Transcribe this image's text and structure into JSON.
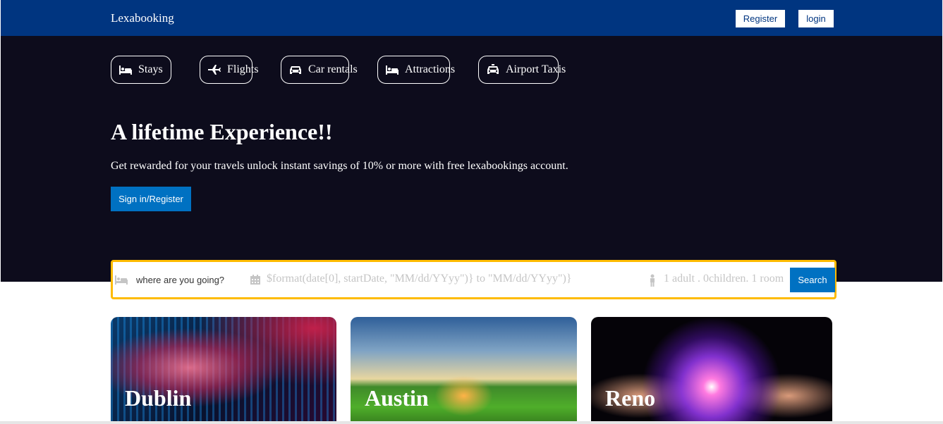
{
  "header": {
    "logo": "Lexabooking",
    "register_label": "Register",
    "login_label": "login"
  },
  "nav_tabs": [
    {
      "label": "Stays",
      "icon": "bed-icon"
    },
    {
      "label": "Flights",
      "icon": "plane-icon"
    },
    {
      "label": "Car rentals",
      "icon": "car-icon"
    },
    {
      "label": "Attractions",
      "icon": "bed-icon"
    },
    {
      "label": "Airport Taxis",
      "icon": "taxi-icon"
    }
  ],
  "hero": {
    "title": "A lifetime Experience!!",
    "subtitle": "Get rewarded for your travels unlock instant savings of 10% or more with free lexabookings account.",
    "cta_label": "Sign in/Register"
  },
  "search": {
    "destination_placeholder": "where are you going?",
    "date_text": "$format(date[0], startDate, \"MM/dd/YYyy\")} to \"MM/dd/YYyy\")}",
    "guests_text": "1 adult . 0children. 1 room",
    "button_label": "Search"
  },
  "cities": [
    {
      "name": "Dublin"
    },
    {
      "name": "Austin"
    },
    {
      "name": "Reno"
    }
  ],
  "colors": {
    "brand_blue": "#003580",
    "hero_bg": "#0d0c1c",
    "button_blue": "#0071c2",
    "search_border": "#febb02"
  }
}
